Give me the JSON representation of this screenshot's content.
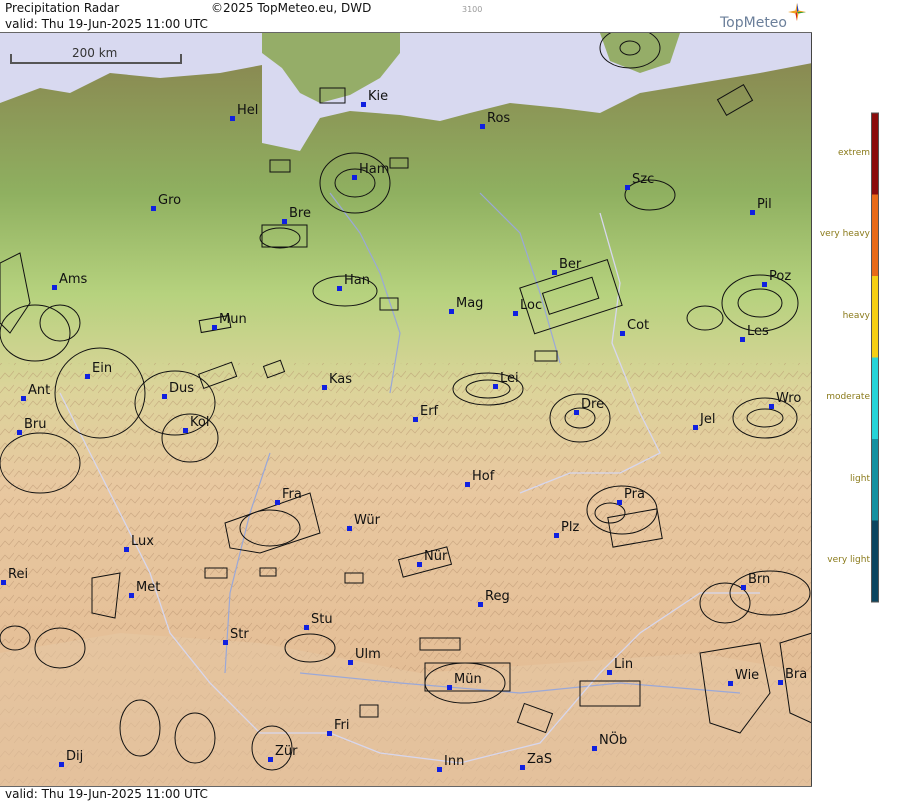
{
  "header": {
    "title": "Precipitation Radar",
    "copyright": "©2025 TopMeteo.eu, DWD",
    "code": "3100",
    "valid": "valid:  Thu  19-Jun-2025 11:00 UTC"
  },
  "footer": {
    "valid": "valid:  Thu  19-Jun-2025 11:00 UTC"
  },
  "logo": {
    "text": "TopMeteo"
  },
  "scale": {
    "label": "200 km"
  },
  "legend": {
    "levels": [
      {
        "label": "extrem",
        "color": "#8b0d0d"
      },
      {
        "label": "very heavy",
        "color": "#e86a18"
      },
      {
        "label": "heavy",
        "color": "#f5cf14"
      },
      {
        "label": "moderate",
        "color": "#25d4d8"
      },
      {
        "label": "light",
        "color": "#1590a0"
      },
      {
        "label": "very light",
        "color": "#0d4660"
      }
    ]
  },
  "cities": [
    "Hel",
    "Kie",
    "Ros",
    "Ham",
    "Szc",
    "Gro",
    "Bre",
    "Pil",
    "Ams",
    "Han",
    "Ber",
    "Poz",
    "Mag",
    "Loc",
    "Mun",
    "Cot",
    "Les",
    "Ein",
    "Kas",
    "Lei",
    "Ant",
    "Dus",
    "Dre",
    "Wro",
    "Bru",
    "Kol",
    "Erf",
    "Jel",
    "Hof",
    "Fra",
    "Pra",
    "Wür",
    "Plz",
    "Lux",
    "Nür",
    "Rei",
    "Met",
    "Reg",
    "Brn",
    "Stu",
    "Str",
    "Ulm",
    "Lin",
    "Mün",
    "Wie",
    "Bra",
    "Fri",
    "Dij",
    "Zür",
    "Inn",
    "ZaS",
    "NÖb"
  ]
}
